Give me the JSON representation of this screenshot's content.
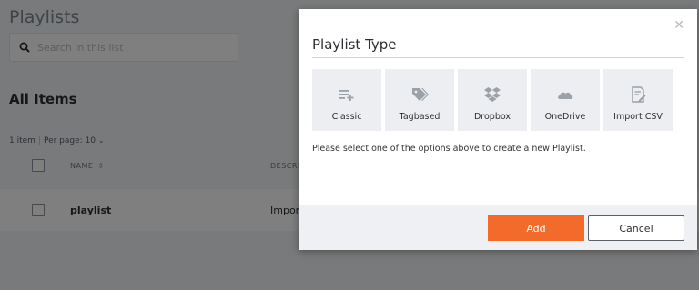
{
  "page": {
    "title": "Playlists",
    "search_placeholder": "Search in this list",
    "section_title": "All Items",
    "pager": {
      "count_text": "1 item",
      "per_page_label": "Per page:",
      "per_page_value": "10"
    },
    "table": {
      "columns": [
        "NAME",
        "DESCRI"
      ],
      "rows": [
        {
          "name": "playlist",
          "description": "Impor"
        }
      ]
    }
  },
  "modal": {
    "title": "Playlist Type",
    "close_icon": "close-icon",
    "types": [
      {
        "label": "Classic",
        "icon": "classic-playlist-icon"
      },
      {
        "label": "Tagbased",
        "icon": "tag-icon"
      },
      {
        "label": "Dropbox",
        "icon": "dropbox-icon"
      },
      {
        "label": "OneDrive",
        "icon": "onedrive-icon"
      },
      {
        "label": "Import CSV",
        "icon": "import-csv-icon"
      }
    ],
    "hint": "Please select one of the options above to create a new Playlist.",
    "add_label": "Add",
    "cancel_label": "Cancel"
  },
  "colors": {
    "accent": "#f26b2a",
    "icon_gray": "#9aa1a8"
  }
}
